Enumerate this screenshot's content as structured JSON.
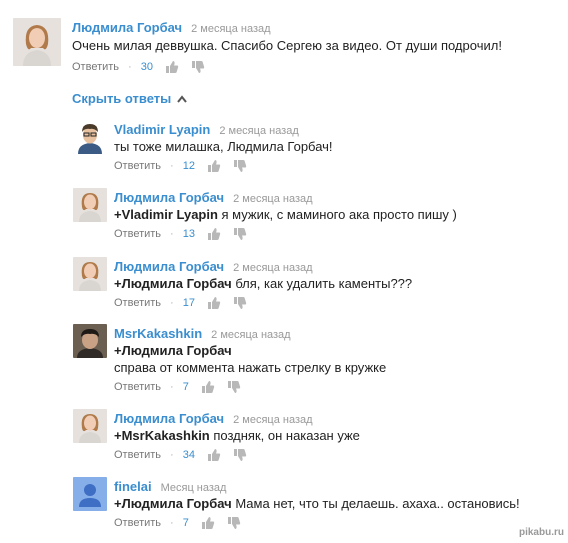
{
  "main_comment": {
    "author": "Людмила Горбач",
    "time": "2 месяца назад",
    "text": "Очень милая деввушка. Спасибо Сергею за видео. От души подрочил!",
    "reply": "Ответить",
    "likes": "30",
    "avatar_icon": "woman-avatar"
  },
  "replies_toggle": {
    "label": "Скрыть ответы",
    "icon": "chevron-up-icon"
  },
  "replies": [
    {
      "author": "Vladimir Lyapin",
      "time": "2 месяца назад",
      "mention": "",
      "text": "ты тоже милашка, Людмила Горбач!",
      "text2": "",
      "reply": "Ответить",
      "likes": "12",
      "avatar_icon": "man-avatar"
    },
    {
      "author": "Людмила Горбач",
      "time": "2 месяца назад",
      "mention": "+Vladimir Lyapin",
      "text": " я мужик, с маминого ака просто пишу )",
      "text2": "",
      "reply": "Ответить",
      "likes": "13",
      "avatar_icon": "woman-avatar"
    },
    {
      "author": "Людмила Горбач",
      "time": "2 месяца назад",
      "mention": "+Людмила Горбач",
      "text": " бля, как удалить каменты???",
      "text2": "",
      "reply": "Ответить",
      "likes": "17",
      "avatar_icon": "woman-avatar"
    },
    {
      "author": "MsrKakashkin",
      "time": "2 месяца назад",
      "mention": "+Людмила Горбач",
      "text": "",
      "text2": "справа от коммента нажать стрелку в кружке",
      "reply": "Ответить",
      "likes": "7",
      "avatar_icon": "dark-man-avatar"
    },
    {
      "author": "Людмила Горбач",
      "time": "2 месяца назад",
      "mention": "+MsrKakashkin",
      "text": " поздняк, он наказан уже",
      "text2": "",
      "reply": "Ответить",
      "likes": "34",
      "avatar_icon": "woman-avatar"
    },
    {
      "author": "finelai",
      "time": "Месяц назад",
      "mention": "+Людмила Горбач",
      "text": " Мама нет, что ты делаешь. ахаха.. остановись!",
      "text2": "",
      "reply": "Ответить",
      "likes": "7",
      "avatar_icon": "default-user-avatar"
    }
  ],
  "watermark": "pikabu.ru",
  "colors": {
    "link": "#3a8ecf",
    "meta": "#999999",
    "text": "#222222",
    "icon": "#b8b8b8"
  }
}
